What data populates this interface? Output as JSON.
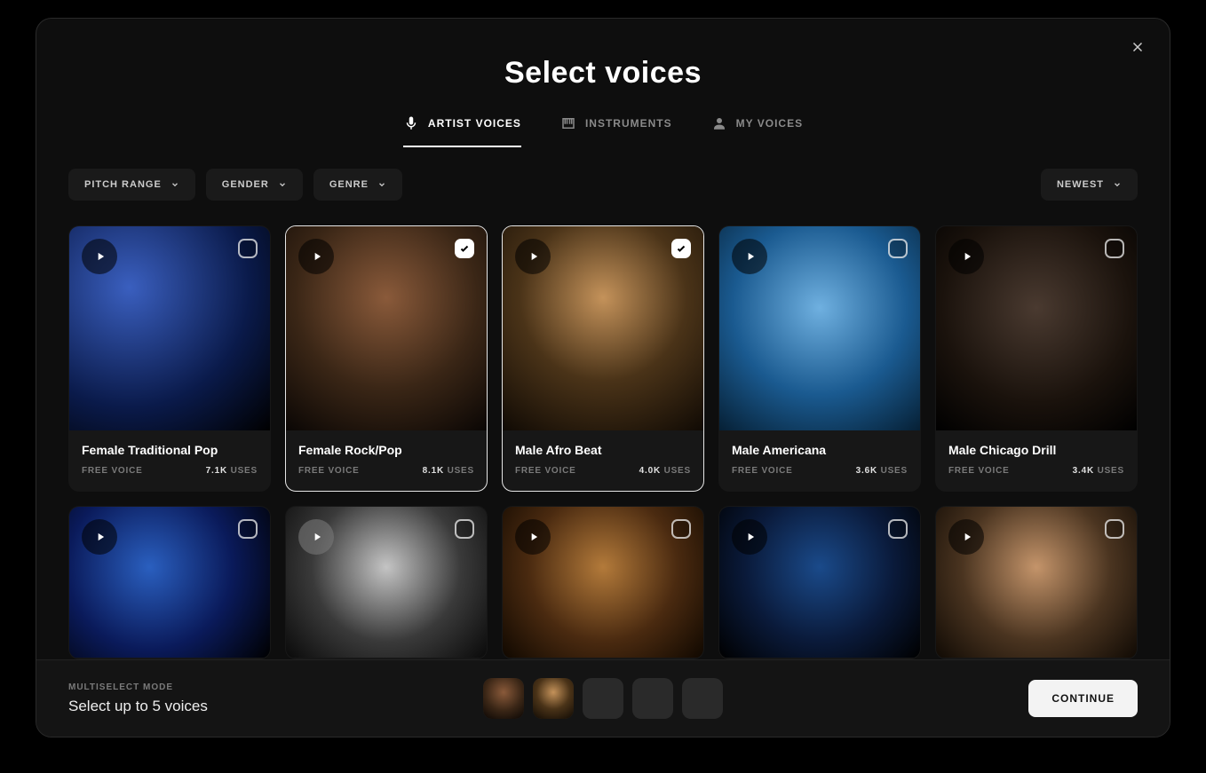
{
  "modal": {
    "title": "Select voices",
    "tabs": [
      {
        "label": "ARTIST VOICES",
        "active": true
      },
      {
        "label": "INSTRUMENTS",
        "active": false
      },
      {
        "label": "MY VOICES",
        "active": false
      }
    ],
    "filters": {
      "pitch": "PITCH RANGE",
      "gender": "GENDER",
      "genre": "GENRE"
    },
    "sort": "NEWEST"
  },
  "voices": [
    {
      "name": "Female Traditional Pop",
      "badge": "FREE VOICE",
      "uses": "7.1K",
      "uses_label": "USES",
      "selected": false
    },
    {
      "name": "Female Rock/Pop",
      "badge": "FREE VOICE",
      "uses": "8.1K",
      "uses_label": "USES",
      "selected": true
    },
    {
      "name": "Male Afro Beat",
      "badge": "FREE VOICE",
      "uses": "4.0K",
      "uses_label": "USES",
      "selected": true
    },
    {
      "name": "Male Americana",
      "badge": "FREE VOICE",
      "uses": "3.6K",
      "uses_label": "USES",
      "selected": false
    },
    {
      "name": "Male Chicago Drill",
      "badge": "FREE VOICE",
      "uses": "3.4K",
      "uses_label": "USES",
      "selected": false
    }
  ],
  "footer": {
    "mode": "MULTISELECT MODE",
    "instruction": "Select up to 5 voices",
    "continue": "CONTINUE",
    "slots": 5,
    "filled": 2
  }
}
